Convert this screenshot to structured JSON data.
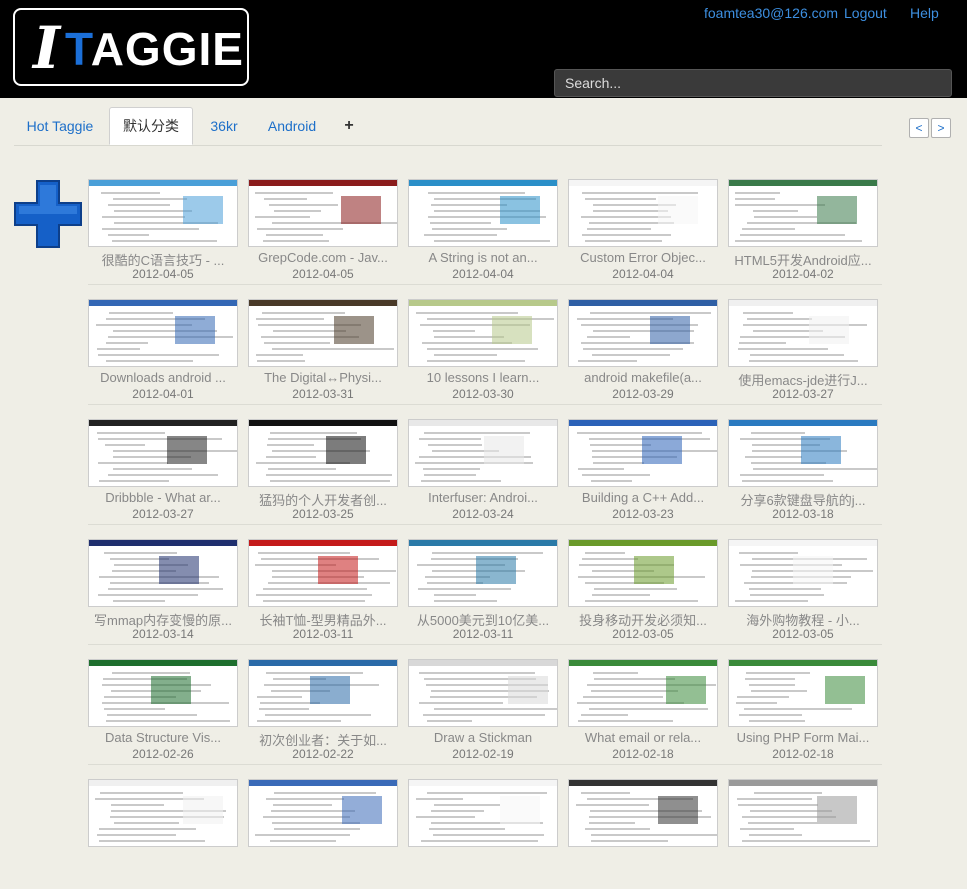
{
  "header": {
    "logo_letter": "I",
    "logo_text_t": "T",
    "logo_text_rest": "AGGIE",
    "user_email": "foamtea30@126.com",
    "logout_label": "Logout",
    "help_label": "Help",
    "search_placeholder": "Search..."
  },
  "tabs": [
    {
      "label": "Hot Taggie",
      "active": false
    },
    {
      "label": "默认分类",
      "active": true
    },
    {
      "label": "36kr",
      "active": false
    },
    {
      "label": "Android",
      "active": false
    }
  ],
  "add_tab_label": "+",
  "pager": {
    "prev": "<",
    "next": ">"
  },
  "bookmarks": [
    {
      "title": "很酷的C语言技巧 - ...",
      "date": "2012-04-05",
      "accent": "#4a9fd8"
    },
    {
      "title": "GrepCode.com - Jav...",
      "date": "2012-04-05",
      "accent": "#8b1c1c"
    },
    {
      "title": "A String is not an...",
      "date": "2012-04-04",
      "accent": "#2a8fc8"
    },
    {
      "title": "Custom Error Objec...",
      "date": "2012-04-04",
      "accent": "#f5f5f5"
    },
    {
      "title": "HTML5开发Android应...",
      "date": "2012-04-02",
      "accent": "#3a7a4a"
    },
    {
      "title": "Downloads android ...",
      "date": "2012-04-01",
      "accent": "#3367b5"
    },
    {
      "title": "The Digital↔Physi...",
      "date": "2012-03-31",
      "accent": "#4a3a28"
    },
    {
      "title": "10 lessons I learn...",
      "date": "2012-03-30",
      "accent": "#b7c98a"
    },
    {
      "title": "android makefile(a...",
      "date": "2012-03-29",
      "accent": "#2f5fa5"
    },
    {
      "title": "使用emacs-jde进行J...",
      "date": "2012-03-27",
      "accent": "#f0f0f0"
    },
    {
      "title": "Dribbble - What ar...",
      "date": "2012-03-27",
      "accent": "#222222"
    },
    {
      "title": "猛犸的个人开发者创...",
      "date": "2012-03-25",
      "accent": "#111111"
    },
    {
      "title": "Interfuser: Androi...",
      "date": "2012-03-24",
      "accent": "#e8e8e8"
    },
    {
      "title": "Building a C++ Add...",
      "date": "2012-03-23",
      "accent": "#2b62b8"
    },
    {
      "title": "分享6款键盘导航的j...",
      "date": "2012-03-18",
      "accent": "#2a7ac0"
    },
    {
      "title": "写mmap内存变慢的原...",
      "date": "2012-03-14",
      "accent": "#1f2f6e"
    },
    {
      "title": "长袖T恤-型男精品外...",
      "date": "2012-03-11",
      "accent": "#c41a1a"
    },
    {
      "title": "从5000美元到10亿美...",
      "date": "2012-03-11",
      "accent": "#2a7aa8"
    },
    {
      "title": "投身移动开发必须知...",
      "date": "2012-03-05",
      "accent": "#6a9a2a"
    },
    {
      "title": "海外购物教程 - 小...",
      "date": "2012-03-05",
      "accent": "#f5f5f5"
    },
    {
      "title": "Data Structure Vis...",
      "date": "2012-02-26",
      "accent": "#1e6e2e"
    },
    {
      "title": "初次创业者：关于如...",
      "date": "2012-02-22",
      "accent": "#2a6aa8"
    },
    {
      "title": "Draw a Stickman",
      "date": "2012-02-19",
      "accent": "#d8d8d8"
    },
    {
      "title": "What email or rela...",
      "date": "2012-02-18",
      "accent": "#3a8a3a"
    },
    {
      "title": "Using PHP Form Mai...",
      "date": "2012-02-18",
      "accent": "#3a8a3a"
    },
    {
      "title": "",
      "date": "",
      "accent": "#f0f0f0"
    },
    {
      "title": "",
      "date": "",
      "accent": "#3a6ab8"
    },
    {
      "title": "",
      "date": "",
      "accent": "#f5f5f5"
    },
    {
      "title": "",
      "date": "",
      "accent": "#333333"
    },
    {
      "title": "",
      "date": "",
      "accent": "#9a9a9a"
    }
  ]
}
